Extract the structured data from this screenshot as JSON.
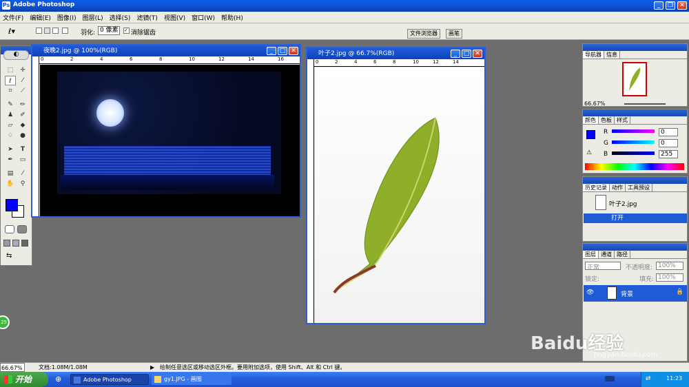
{
  "app": {
    "title": "Adobe Photoshop"
  },
  "menu": [
    "文件(F)",
    "编辑(E)",
    "图像(I)",
    "图层(L)",
    "选择(S)",
    "滤镜(T)",
    "视图(V)",
    "窗口(W)",
    "帮助(H)"
  ],
  "options": {
    "feather_label": "羽化:",
    "feather_value": "0 像素",
    "antialias_label": "消除锯齿"
  },
  "palette_tabs": [
    "文件浏览器",
    "画笔"
  ],
  "doc1": {
    "title": "夜晚2.jpg @ 100%(RGB)",
    "ruler": [
      "0",
      "2",
      "4",
      "6",
      "8",
      "10",
      "12",
      "14",
      "16"
    ]
  },
  "doc2": {
    "title": "叶子2.jpg @ 66.7%(RGB)",
    "ruler": [
      "0",
      "2",
      "4",
      "6",
      "8",
      "10",
      "12",
      "14"
    ]
  },
  "navigator": {
    "tabs": [
      "导航器",
      "信息"
    ],
    "zoom": "66.67%"
  },
  "color": {
    "tabs": [
      "颜色",
      "色板",
      "样式"
    ],
    "r_label": "R",
    "g_label": "G",
    "b_label": "B",
    "r": "0",
    "g": "0",
    "b": "255",
    "fg": "#0000ff"
  },
  "history": {
    "tabs": [
      "历史记录",
      "动作",
      "工具预设"
    ],
    "snapshot": "叶子2.jpg",
    "step": "打开"
  },
  "layers": {
    "tabs": [
      "图层",
      "通道",
      "路径"
    ],
    "mode": "正常",
    "opacity_label": "不透明度:",
    "opacity": "100%",
    "lock_label": "锁定:",
    "fill_label": "填充:",
    "fill": "100%",
    "layer_name": "背景"
  },
  "status": {
    "zoom": "66.67%",
    "doc": "文档:1.08M/1.08M",
    "hint": "绘制任意选区或移动选区外框。要用附加选项，使用 Shift、Alt 和 Ctrl 键。"
  },
  "taskbar": {
    "start": "开始",
    "items": [
      "Adobe Photoshop",
      "gy1.JPG - 画图"
    ],
    "time": "11:23"
  },
  "watermark": {
    "brand": "Baidu经验",
    "url": "jingyan.baidu.com"
  },
  "badge": "25"
}
